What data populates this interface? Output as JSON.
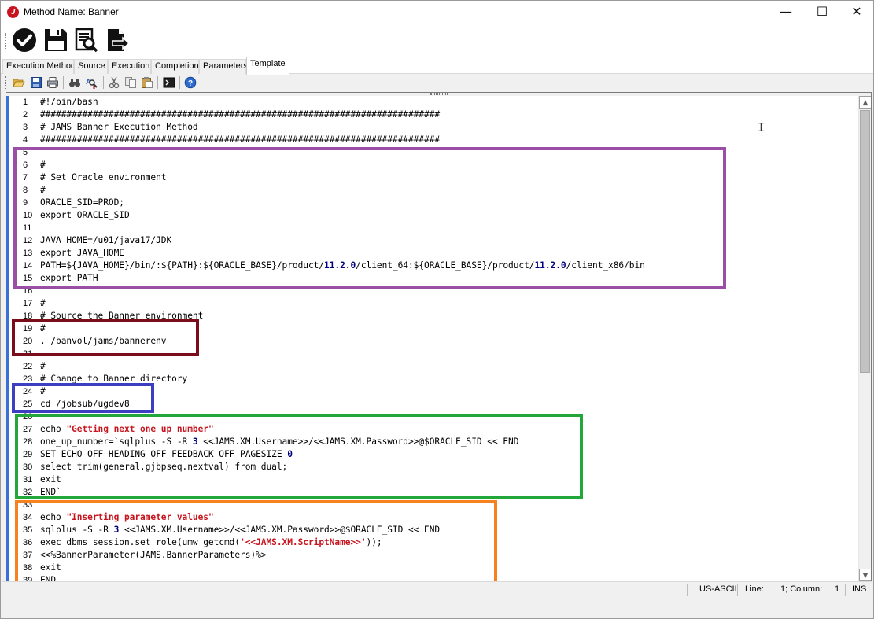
{
  "window": {
    "title": "Method Name: Banner",
    "controls": {
      "minimize": "—",
      "maximize": "☐",
      "close": "✕"
    }
  },
  "main_toolbar": {
    "buttons": [
      {
        "icon": "checkmark-icon"
      },
      {
        "icon": "save-icon"
      },
      {
        "icon": "find-in-document-icon"
      },
      {
        "icon": "export-document-icon"
      }
    ]
  },
  "tabs": [
    {
      "label": "Execution Method",
      "active": false
    },
    {
      "label": "Source",
      "active": false
    },
    {
      "label": "Execution",
      "active": false
    },
    {
      "label": "Completion",
      "active": false
    },
    {
      "label": "Parameters",
      "active": false
    },
    {
      "label": "Template",
      "active": true
    }
  ],
  "editor_toolbar": {
    "buttons": [
      "open-folder-icon",
      "save-icon",
      "print-icon",
      "find-icon",
      "find-replace-icon",
      "cut-icon",
      "copy-icon",
      "paste-icon",
      "macro-icon",
      "help-icon"
    ]
  },
  "code": {
    "lines": [
      {
        "num": "1",
        "text": "#!/bin/bash"
      },
      {
        "num": "2",
        "text": "############################################################################"
      },
      {
        "num": "3",
        "text": "# JAMS Banner Execution Method"
      },
      {
        "num": "4",
        "text": "############################################################################"
      },
      {
        "num": "5",
        "text": ""
      },
      {
        "num": "6",
        "text": "#"
      },
      {
        "num": "7",
        "text": "# Set Oracle environment"
      },
      {
        "num": "8",
        "text": "#"
      },
      {
        "num": "9",
        "text": "ORACLE_SID=PROD;"
      },
      {
        "num": "10",
        "text": "export ORACLE_SID"
      },
      {
        "num": "11",
        "text": ""
      },
      {
        "num": "12",
        "text": "JAVA_HOME=/u01/java17/JDK"
      },
      {
        "num": "13",
        "text": "export JAVA_HOME"
      },
      {
        "num": "14",
        "text": "PATH=${JAVA_HOME}/bin/:${PATH}:${ORACLE_BASE}/product/11.2.0/client_64:${ORACLE_BASE}/product/11.2.0/client_x86/bin"
      },
      {
        "num": "15",
        "text": "export PATH"
      },
      {
        "num": "16",
        "text": ""
      },
      {
        "num": "17",
        "text": "#"
      },
      {
        "num": "18",
        "text": "# Source the Banner environment"
      },
      {
        "num": "19",
        "text": "#"
      },
      {
        "num": "20",
        "text": ". /banvol/jams/bannerenv"
      },
      {
        "num": "21",
        "text": ""
      },
      {
        "num": "22",
        "text": "#"
      },
      {
        "num": "23",
        "text": "# Change to Banner directory"
      },
      {
        "num": "24",
        "text": "#"
      },
      {
        "num": "25",
        "text": "cd /jobsub/ugdev8"
      },
      {
        "num": "26",
        "text": ""
      },
      {
        "num": "27",
        "text": "echo \"Getting next one up number\""
      },
      {
        "num": "28",
        "text": "one_up_number=`sqlplus -S -R 3 <<JAMS.XM.Username>>/<<JAMS.XM.Password>>@$ORACLE_SID << END"
      },
      {
        "num": "29",
        "text": "SET ECHO OFF HEADING OFF FEEDBACK OFF PAGESIZE 0"
      },
      {
        "num": "30",
        "text": "select trim(general.gjbpseq.nextval) from dual;"
      },
      {
        "num": "31",
        "text": "exit"
      },
      {
        "num": "32",
        "text": "END`"
      },
      {
        "num": "33",
        "text": ""
      },
      {
        "num": "34",
        "text": "echo \"Inserting parameter values\""
      },
      {
        "num": "35",
        "text": "sqlplus -S -R 3 <<JAMS.XM.Username>>/<<JAMS.XM.Password>>@$ORACLE_SID << END"
      },
      {
        "num": "36",
        "text": "exec dbms_session.set_role(umw_getcmd('<<JAMS.XM.ScriptName>>'));"
      },
      {
        "num": "37",
        "text": "<<%BannerParameter(JAMS.BannerParameters)%>"
      },
      {
        "num": "38",
        "text": "exit"
      },
      {
        "num": "39",
        "text": "END"
      }
    ]
  },
  "highlights": [
    {
      "name": "oracle-env-highlight",
      "color": "#9b4ea6"
    },
    {
      "name": "banner-env-highlight",
      "color": "#7a0c1b"
    },
    {
      "name": "banner-dir-highlight",
      "color": "#3b3fc0"
    },
    {
      "name": "one-up-number-highlight",
      "color": "#22a83a"
    },
    {
      "name": "parameter-values-highlight",
      "color": "#f5821f"
    }
  ],
  "status": {
    "encoding": "US-ASCII",
    "line_label": "Line:",
    "line_value": "1; Column:",
    "column_value": "1",
    "mode": "INS"
  }
}
